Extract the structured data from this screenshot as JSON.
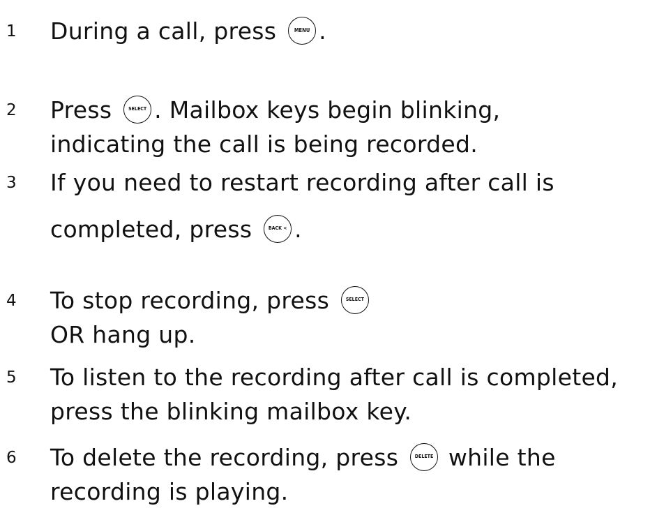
{
  "steps": [
    {
      "number": "1",
      "line1_before": "During a call, press ",
      "key1": "MENU",
      "line1_after": "."
    },
    {
      "number": "2",
      "line1_before": "Press ",
      "key1": "SELECT",
      "line1_after": ". Mailbox keys begin blinking,",
      "line2": "indicating the call is being recorded."
    },
    {
      "number": "3",
      "line1": "If you need to restart recording after call is",
      "line2_before": "completed, press ",
      "key2": "BACK <",
      "line2_after": "."
    },
    {
      "number": "4",
      "line1_before": "To stop recording, press ",
      "key1": "SELECT",
      "line2": "OR hang up."
    },
    {
      "number": "5",
      "line1": "To listen to the recording after call is completed,",
      "line2": "press the blinking mailbox key."
    },
    {
      "number": "6",
      "line1_before": "To delete the recording, press ",
      "key1": "DELETE",
      "line1_after": " while the",
      "line2": "recording is playing."
    }
  ]
}
